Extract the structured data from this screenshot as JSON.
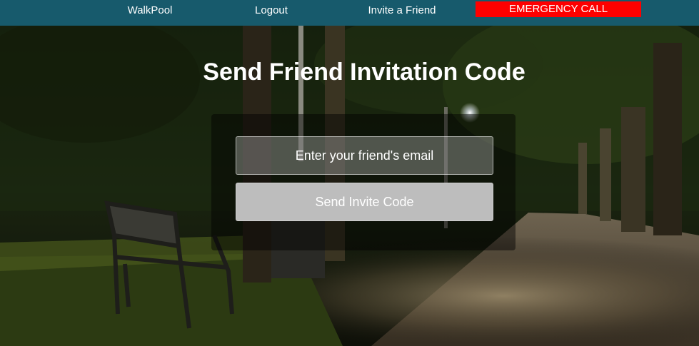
{
  "nav": {
    "items": [
      {
        "label": "WalkPool"
      },
      {
        "label": "Logout"
      },
      {
        "label": "Invite a Friend"
      }
    ],
    "emergency_label": "EMERGENCY CALL"
  },
  "main": {
    "title": "Send Friend Invitation Code",
    "email_placeholder": "Enter your friend's email",
    "email_value": "",
    "send_button_label": "Send Invite Code"
  },
  "colors": {
    "navbar": "#175a6c",
    "emergency": "#ff0000",
    "button": "#bdbdbd",
    "text": "#ffffff"
  },
  "icons": {
    "background": "night-park-path-bench-image"
  }
}
